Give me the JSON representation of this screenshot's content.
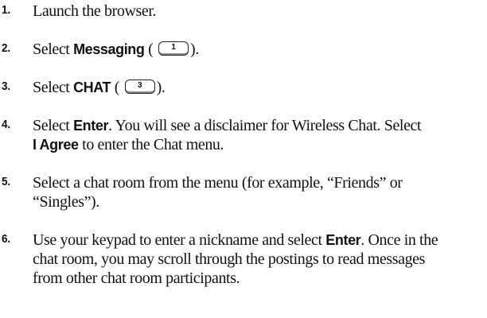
{
  "steps": [
    {
      "number": "1.",
      "lines": [
        {
          "text": "Launch the browser."
        }
      ]
    },
    {
      "number": "2.",
      "select_prefix": "Select ",
      "keyword": "Messaging",
      "paren_open": " (",
      "key_label": "1",
      "paren_close": ")."
    },
    {
      "number": "3.",
      "select_prefix": "Select ",
      "keyword": "CHAT",
      "paren_open": " (",
      "key_label": "3",
      "paren_close": ")."
    },
    {
      "number": "4.",
      "line1_prefix": "Select ",
      "line1_keyword": "Enter",
      "line1_suffix": ". You will see a disclaimer for Wireless Chat. Select",
      "line2_keyword": "I Agree",
      "line2_suffix": " to enter the Chat menu."
    },
    {
      "number": "5.",
      "line1": "Select a chat room from the menu (for example, “Friends” or",
      "line2": "“Singles”)."
    },
    {
      "number": "6.",
      "line1_prefix": "Use your keypad to enter a nickname and select ",
      "line1_keyword": "Enter",
      "line1_suffix": ". Once in the",
      "line2": "chat room, you may scroll through the postings to read messages",
      "line3": "from other chat room participants."
    }
  ]
}
